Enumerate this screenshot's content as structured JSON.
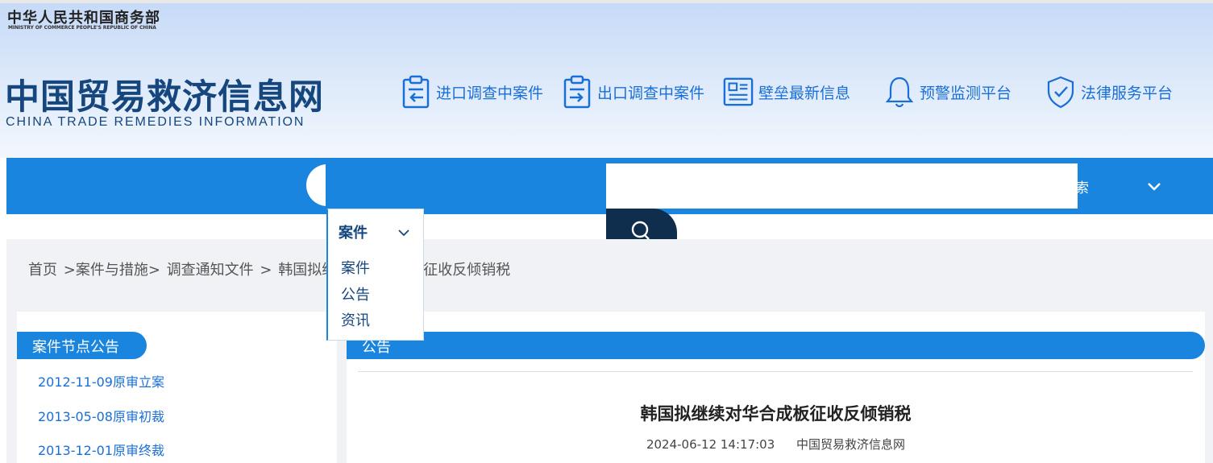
{
  "header": {
    "ministry_cn": "中华人民共和国商务部",
    "ministry_en": "MINISTRY OF COMMERCE PEOPLE'S REPUBLIC OF CHINA",
    "site_title_cn": "中国贸易救济信息网",
    "site_title_en": "CHINA TRADE REMEDIES INFORMATION",
    "quick_links": [
      {
        "label": "进口调查中案件",
        "icon": "clipboard-import-icon"
      },
      {
        "label": "出口调查中案件",
        "icon": "clipboard-export-icon"
      },
      {
        "label": "壁垒最新信息",
        "icon": "document-list-icon"
      },
      {
        "label": "预警监测平台",
        "icon": "bell-icon"
      },
      {
        "label": "法律服务平台",
        "icon": "shield-check-icon"
      }
    ]
  },
  "nav": {
    "search_partial_label": "搜索",
    "search_input_value": "",
    "search_placeholder": ""
  },
  "dropdown": {
    "selected": "案件",
    "options": [
      "案件",
      "公告",
      "资讯"
    ]
  },
  "breadcrumb": {
    "items": [
      "首页",
      ">案件与措施>",
      "调查通知文件",
      ">",
      "韩国拟继续对华合成板征收反倾销税"
    ]
  },
  "left_panel": {
    "title": "案件节点公告",
    "items": [
      "2012-11-09原审立案",
      "2013-05-08原审初裁",
      "2013-12-01原审终裁"
    ]
  },
  "right_panel": {
    "title": "公告",
    "article_title": "韩国拟继续对华合成板征收反倾销税",
    "article_datetime": "2024-06-12 14:17:03",
    "article_source": "中国贸易救济信息网"
  },
  "colors": {
    "primary_blue": "#1a85de",
    "dark_navy": "#16467e",
    "link_blue": "#1a6fd6",
    "search_button": "#0f2d4c"
  }
}
